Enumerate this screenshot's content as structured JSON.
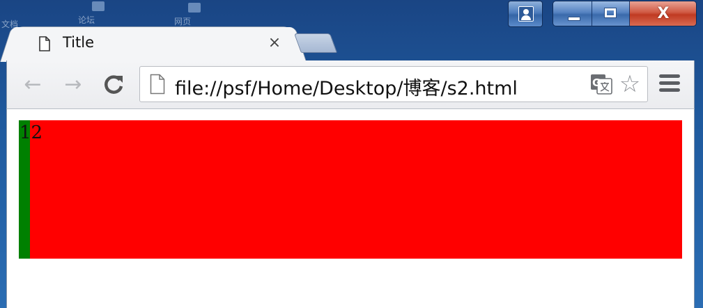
{
  "desktop": {
    "icons": [
      "文档",
      "论坛",
      "网页"
    ]
  },
  "window": {
    "close_glyph": "X"
  },
  "tab": {
    "title": "Title",
    "close_glyph": "×"
  },
  "toolbar": {
    "back_glyph": "←",
    "forward_glyph": "→",
    "reload_glyph": "C",
    "star_glyph": "☆"
  },
  "omnibox": {
    "url": "file://psf/Home/Desktop/博客/s2.html"
  },
  "page": {
    "text_1": "1",
    "text_2": "2",
    "colors": {
      "box": "#ff0000",
      "strip": "#008000"
    }
  }
}
